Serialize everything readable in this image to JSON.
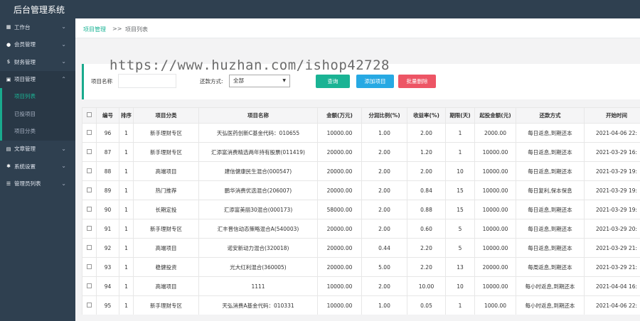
{
  "app": {
    "title": "后台管理系统"
  },
  "sidebar": {
    "items": [
      {
        "label": "工作台",
        "icon": "dashboard-icon"
      },
      {
        "label": "会员管理",
        "icon": "user-icon"
      },
      {
        "label": "财务管理",
        "icon": "money-icon"
      },
      {
        "label": "项目管理",
        "icon": "folder-icon"
      },
      {
        "label": "文章管理",
        "icon": "file-icon"
      },
      {
        "label": "系统设置",
        "icon": "gear-icon"
      },
      {
        "label": "管理员列表",
        "icon": "list-icon"
      }
    ],
    "project_sub": [
      "项目列表",
      "已投项目",
      "项目分类"
    ]
  },
  "breadcrumb": {
    "level1": "项目管理",
    "sep": ">>",
    "level2": "项目列表"
  },
  "watermark": "https://www.huzhan.com/ishop42728",
  "filter": {
    "name_label": "项目名称",
    "name_value": "",
    "mode_label": "还款方式:",
    "mode_value": "全部",
    "search_label": "查询",
    "add_label": "添加项目",
    "delete_label": "批量删除"
  },
  "table": {
    "columns": [
      "",
      "编号",
      "排序",
      "项目分类",
      "项目名称",
      "金额(万元)",
      "分润比例(%)",
      "收益率(%)",
      "期限(天)",
      "起投金额(元)",
      "还款方式",
      "开始时间"
    ],
    "rows": [
      [
        "96",
        "1",
        "新手理财专区",
        "天弘医药创新C基金代码：010655",
        "10000.00",
        "1.00",
        "2.00",
        "1",
        "2000.00",
        "每日返息,到期还本",
        "2021-04-06 22:"
      ],
      [
        "87",
        "1",
        "新手理财专区",
        "汇添富消费精选两年持有股票(011419)",
        "20000.00",
        "2.00",
        "1.20",
        "1",
        "10000.00",
        "每日返息,到期还本",
        "2021-03-29 16:"
      ],
      [
        "88",
        "1",
        "高端项目",
        "建信健康民生混合(000547)",
        "20000.00",
        "2.00",
        "2.00",
        "10",
        "10000.00",
        "每日返息,到期还本",
        "2021-03-29 19:"
      ],
      [
        "89",
        "1",
        "热门推荐",
        "鹏华消费优选混合(206007)",
        "20000.00",
        "2.00",
        "0.84",
        "15",
        "10000.00",
        "每日复利,保本保息",
        "2021-03-29 19:"
      ],
      [
        "90",
        "1",
        "长期定投",
        "汇添富美丽30混合(000173)",
        "58000.00",
        "2.00",
        "0.88",
        "15",
        "10000.00",
        "每日返息,到期还本",
        "2021-03-29 19:"
      ],
      [
        "91",
        "1",
        "新手理财专区",
        "汇丰晋信动态策略混合A(540003)",
        "20000.00",
        "2.00",
        "0.60",
        "5",
        "10000.00",
        "每日返息,到期还本",
        "2021-03-29 20:"
      ],
      [
        "92",
        "1",
        "高端项目",
        "诺安新动力混合(320018)",
        "20000.00",
        "0.44",
        "2.20",
        "5",
        "10000.00",
        "每日返息,到期还本",
        "2021-03-29 21:"
      ],
      [
        "93",
        "1",
        "稳健投资",
        "光大红利混合(360005)",
        "20000.00",
        "5.00",
        "2.20",
        "13",
        "20000.00",
        "每周返息,到期还本",
        "2021-03-29 21:"
      ],
      [
        "94",
        "1",
        "高端项目",
        "1111",
        "10000.00",
        "2.00",
        "10.00",
        "10",
        "10000.00",
        "每小时返息,到期还本",
        "2021-04-04 16:"
      ],
      [
        "95",
        "1",
        "新手理财专区",
        "天弘消费A基金代码：010331",
        "10000.00",
        "1.00",
        "0.05",
        "1",
        "1000.00",
        "每小时返息,到期还本",
        "2021-04-06 22:"
      ]
    ]
  },
  "colors": {
    "sidebar": "#2f4050",
    "accent": "#1ab394",
    "add": "#27a9e3",
    "danger": "#ed5565"
  }
}
